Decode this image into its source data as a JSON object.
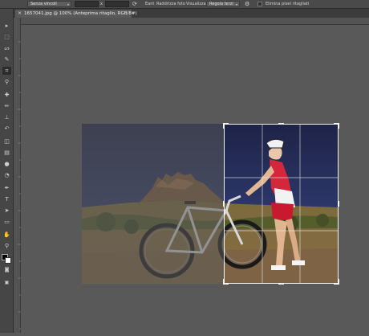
{
  "options_bar": {
    "ratio_select": "Senza vincoli",
    "swap_label": "x",
    "clear_label": "Eant",
    "straighten_label": "Raddrizza foto",
    "view_label": "Visualizza:",
    "view_select": "Regola terzi",
    "delete_pixels_label": "Elimina pixel ritagliati"
  },
  "document": {
    "tab_title": "1657041.jpg @ 100% (Anteprima ritaglio, RGB/8#)",
    "close_symbol": "×"
  },
  "toolbar": {
    "tools": [
      {
        "name": "move-tool",
        "glyph": "▸"
      },
      {
        "name": "marquee-tool",
        "glyph": "⬚"
      },
      {
        "name": "lasso-tool",
        "glyph": "ᔕ"
      },
      {
        "name": "quick-select-tool",
        "glyph": "✎"
      },
      {
        "name": "crop-tool",
        "glyph": "⌗"
      },
      {
        "name": "eyedropper-tool",
        "glyph": "⚲"
      },
      {
        "name": "healing-brush-tool",
        "glyph": "✚"
      },
      {
        "name": "brush-tool",
        "glyph": "✏"
      },
      {
        "name": "clone-stamp-tool",
        "glyph": "⊥"
      },
      {
        "name": "history-brush-tool",
        "glyph": "↶"
      },
      {
        "name": "eraser-tool",
        "glyph": "◫"
      },
      {
        "name": "gradient-tool",
        "glyph": "▤"
      },
      {
        "name": "blur-tool",
        "glyph": "●"
      },
      {
        "name": "dodge-tool",
        "glyph": "◔"
      },
      {
        "name": "pen-tool",
        "glyph": "✒"
      },
      {
        "name": "type-tool",
        "glyph": "T"
      },
      {
        "name": "path-selection-tool",
        "glyph": "➤"
      },
      {
        "name": "shape-tool",
        "glyph": "▭"
      },
      {
        "name": "hand-tool",
        "glyph": "✋"
      },
      {
        "name": "zoom-tool",
        "glyph": "⚲"
      }
    ]
  },
  "colors": {
    "foreground": "#000000",
    "background": "#ffffff",
    "accent_crop": "#f2f2f2"
  }
}
